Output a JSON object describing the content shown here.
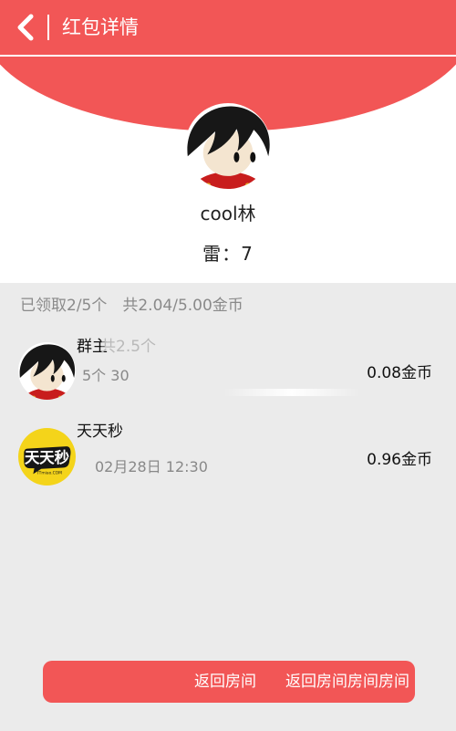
{
  "header": {
    "title": "红包详情"
  },
  "sender": {
    "name": "cool林",
    "mine_info": "雷：7"
  },
  "summary": "已领取2/5个　共2.04/5.00金币",
  "records": [
    {
      "name": "群主",
      "time": "5个 30",
      "amount": "0.08金币",
      "overlay_text": "共2.5个"
    },
    {
      "name": "天天秒",
      "time": "02月28日 12:30",
      "amount": "0.96金币",
      "logo_text": "天天秒",
      "logo_subtext": "TTmiao.COM"
    }
  ],
  "bottom": {
    "button1": "返回房间",
    "button2": "返回房间房间房间"
  },
  "colors": {
    "accent": "#f25656",
    "grey_bg": "#ebebeb"
  }
}
